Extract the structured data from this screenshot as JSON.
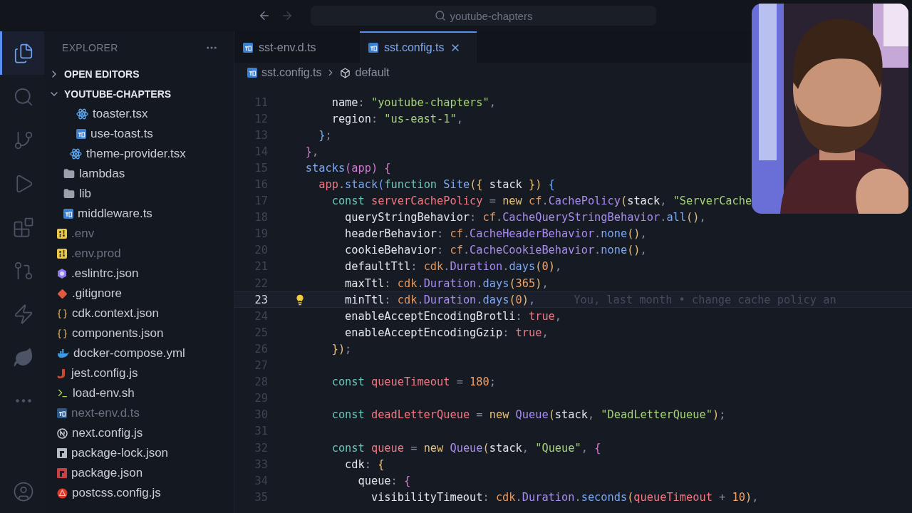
{
  "title_bar": {
    "nav": [
      {
        "kind": "back",
        "disabled": false
      },
      {
        "kind": "forward",
        "disabled": true
      }
    ],
    "command_center": "youtube-chapters"
  },
  "activity_bar": [
    {
      "kind": "explorer",
      "selected": true
    },
    {
      "kind": "search",
      "selected": false
    },
    {
      "kind": "scm",
      "selected": false
    },
    {
      "kind": "debug",
      "selected": false
    },
    {
      "kind": "extensions",
      "selected": false
    },
    {
      "kind": "remote",
      "selected": false
    },
    {
      "kind": "lightning",
      "selected": false
    },
    {
      "kind": "leaf",
      "selected": false
    },
    {
      "kind": "more",
      "selected": false
    },
    {
      "kind": "account",
      "selected": false
    }
  ],
  "explorer": {
    "title": "EXPLORER",
    "sections": [
      {
        "label": "OPEN EDITORS",
        "expanded": false
      },
      {
        "label": "YOUTUBE-CHAPTERS",
        "expanded": true
      }
    ],
    "tree": [
      {
        "children": [
          {
            "children": [
              {
                "children": [
                  {
                    "label": "toaster.tsx",
                    "kind": "react",
                    "ignored": false
                  },
                  {
                    "label": "use-toast.ts",
                    "kind": "ts",
                    "ignored": false
                  }
                ]
              },
              {
                "label": "theme-provider.tsx",
                "kind": "react",
                "ignored": false
              }
            ]
          },
          {
            "label": "lambdas",
            "kind": "folder",
            "ignored": false
          },
          {
            "label": "lib",
            "kind": "folder",
            "ignored": false
          },
          {
            "label": "middleware.ts",
            "kind": "ts",
            "ignored": false
          }
        ]
      },
      {
        "label": ".env",
        "kind": "env",
        "ignored": true
      },
      {
        "label": ".env.prod",
        "kind": "env",
        "ignored": true
      },
      {
        "label": ".eslintrc.json",
        "kind": "eslint",
        "ignored": false
      },
      {
        "label": ".gitignore",
        "kind": "git",
        "ignored": false
      },
      {
        "label": "cdk.context.json",
        "kind": "json",
        "ignored": false
      },
      {
        "label": "components.json",
        "kind": "json",
        "ignored": false
      },
      {
        "label": "docker-compose.yml",
        "kind": "docker",
        "ignored": false
      },
      {
        "label": "jest.config.js",
        "kind": "jest",
        "ignored": false
      },
      {
        "label": "load-env.sh",
        "kind": "shell",
        "ignored": false
      },
      {
        "label": "next-env.d.ts",
        "kind": "ts",
        "ignored": true
      },
      {
        "label": "next.config.js",
        "kind": "next",
        "ignored": false
      },
      {
        "label": "package-lock.json",
        "kind": "npm",
        "ignored": false
      },
      {
        "label": "package.json",
        "kind": "npmred",
        "ignored": false
      },
      {
        "label": "postcss.config.js",
        "kind": "postcss",
        "ignored": false
      }
    ]
  },
  "tabs": [
    {
      "label": "sst-env.d.ts",
      "selected": false
    },
    {
      "label": "sst.config.ts",
      "selected": true
    }
  ],
  "breadcrumbs": [
    {
      "label": "sst.config.ts",
      "kind": "file"
    },
    {
      "label": "default",
      "kind": "symbol"
    }
  ],
  "lines": [
    {
      "n": "11",
      "current": false,
      "tokens": [
        {
          "text": "        name",
          "kind": "prop"
        },
        {
          "text": ":",
          "kind": "p"
        },
        {
          "text": " \"youtube-chapters\"",
          "kind": "str"
        },
        {
          "text": ",",
          "kind": "p"
        }
      ]
    },
    {
      "n": "12",
      "current": false,
      "tokens": [
        {
          "text": "        region",
          "kind": "prop"
        },
        {
          "text": ":",
          "kind": "p"
        },
        {
          "text": " \"us-east-1\"",
          "kind": "str"
        },
        {
          "text": ",",
          "kind": "p"
        }
      ]
    },
    {
      "n": "13",
      "current": false,
      "tokens": [
        {
          "text": "      }",
          "kind": "b3"
        },
        {
          "text": ";",
          "kind": "p"
        }
      ]
    },
    {
      "n": "14",
      "current": false,
      "tokens": [
        {
          "text": "    }",
          "kind": "b2"
        },
        {
          "text": ",",
          "kind": "p"
        }
      ]
    },
    {
      "n": "15",
      "current": false,
      "tokens": [
        {
          "text": "    stacks",
          "kind": "fn"
        },
        {
          "text": "(app) {",
          "kind": "b2"
        }
      ]
    },
    {
      "n": "16",
      "current": false,
      "tokens": [
        {
          "text": "      app",
          "kind": "var"
        },
        {
          "text": ".",
          "kind": "p"
        },
        {
          "text": "stack",
          "kind": "fn"
        },
        {
          "text": "(",
          "kind": "b3"
        },
        {
          "text": "function",
          "kind": "kw"
        },
        {
          "text": " Site",
          "kind": "fn"
        },
        {
          "text": "({",
          "kind": "b1"
        },
        {
          "text": " stack ",
          "kind": "prop"
        },
        {
          "text": "})",
          "kind": "b1"
        },
        {
          "text": " {",
          "kind": "b3"
        }
      ]
    },
    {
      "n": "17",
      "current": false,
      "tokens": [
        {
          "text": "        const",
          "kind": "kw"
        },
        {
          "text": " serverCachePolicy",
          "kind": "var"
        },
        {
          "text": " =",
          "kind": "p"
        },
        {
          "text": " new",
          "kind": "kw2"
        },
        {
          "text": " cf",
          "kind": "obj"
        },
        {
          "text": ".",
          "kind": "p"
        },
        {
          "text": "CachePolicy",
          "kind": "cls"
        },
        {
          "text": "(",
          "kind": "b1"
        },
        {
          "text": "stack",
          "kind": "prop"
        },
        {
          "text": ",",
          "kind": "p"
        },
        {
          "text": " \"ServerCache",
          "kind": "str"
        }
      ]
    },
    {
      "n": "18",
      "current": false,
      "tokens": [
        {
          "text": "          queryStringBehavior",
          "kind": "prop"
        },
        {
          "text": ":",
          "kind": "p"
        },
        {
          "text": " cf",
          "kind": "obj"
        },
        {
          "text": ".",
          "kind": "p"
        },
        {
          "text": "CacheQueryStringBehavior",
          "kind": "cls"
        },
        {
          "text": ".",
          "kind": "p"
        },
        {
          "text": "all",
          "kind": "fn"
        },
        {
          "text": "()",
          "kind": "b1"
        },
        {
          "text": ",",
          "kind": "p"
        }
      ]
    },
    {
      "n": "19",
      "current": false,
      "tokens": [
        {
          "text": "          headerBehavior",
          "kind": "prop"
        },
        {
          "text": ":",
          "kind": "p"
        },
        {
          "text": " cf",
          "kind": "obj"
        },
        {
          "text": ".",
          "kind": "p"
        },
        {
          "text": "CacheHeaderBehavior",
          "kind": "cls"
        },
        {
          "text": ".",
          "kind": "p"
        },
        {
          "text": "none",
          "kind": "fn"
        },
        {
          "text": "()",
          "kind": "b1"
        },
        {
          "text": ",",
          "kind": "p"
        }
      ]
    },
    {
      "n": "20",
      "current": false,
      "tokens": [
        {
          "text": "          cookieBehavior",
          "kind": "prop"
        },
        {
          "text": ":",
          "kind": "p"
        },
        {
          "text": " cf",
          "kind": "obj"
        },
        {
          "text": ".",
          "kind": "p"
        },
        {
          "text": "CacheCookieBehavior",
          "kind": "cls"
        },
        {
          "text": ".",
          "kind": "p"
        },
        {
          "text": "none",
          "kind": "fn"
        },
        {
          "text": "()",
          "kind": "b1"
        },
        {
          "text": ",",
          "kind": "p"
        }
      ]
    },
    {
      "n": "21",
      "current": false,
      "tokens": [
        {
          "text": "          defaultTtl",
          "kind": "prop"
        },
        {
          "text": ":",
          "kind": "p"
        },
        {
          "text": " cdk",
          "kind": "obj"
        },
        {
          "text": ".",
          "kind": "p"
        },
        {
          "text": "Duration",
          "kind": "cls"
        },
        {
          "text": ".",
          "kind": "p"
        },
        {
          "text": "days",
          "kind": "fn"
        },
        {
          "text": "(",
          "kind": "b1"
        },
        {
          "text": "0",
          "kind": "num"
        },
        {
          "text": ")",
          "kind": "b1"
        },
        {
          "text": ",",
          "kind": "p"
        }
      ]
    },
    {
      "n": "22",
      "current": false,
      "tokens": [
        {
          "text": "          maxTtl",
          "kind": "prop"
        },
        {
          "text": ":",
          "kind": "p"
        },
        {
          "text": " cdk",
          "kind": "obj"
        },
        {
          "text": ".",
          "kind": "p"
        },
        {
          "text": "Duration",
          "kind": "cls"
        },
        {
          "text": ".",
          "kind": "p"
        },
        {
          "text": "days",
          "kind": "fn"
        },
        {
          "text": "(",
          "kind": "b1"
        },
        {
          "text": "365",
          "kind": "num"
        },
        {
          "text": ")",
          "kind": "b1"
        },
        {
          "text": ",",
          "kind": "p"
        }
      ]
    },
    {
      "n": "23",
      "current": true,
      "tokens": [
        {
          "text": "          minTtl",
          "kind": "prop"
        },
        {
          "text": ":",
          "kind": "p"
        },
        {
          "text": " cdk",
          "kind": "obj"
        },
        {
          "text": ".",
          "kind": "p"
        },
        {
          "text": "Duration",
          "kind": "cls"
        },
        {
          "text": ".",
          "kind": "p"
        },
        {
          "text": "days",
          "kind": "fn"
        },
        {
          "text": "(",
          "kind": "b1"
        },
        {
          "text": "0",
          "kind": "num"
        },
        {
          "text": ")",
          "kind": "b1"
        },
        {
          "text": ",",
          "kind": "p"
        }
      ],
      "blame": "You, last month • change cache policy an"
    },
    {
      "n": "24",
      "current": false,
      "tokens": [
        {
          "text": "          enableAcceptEncodingBrotli",
          "kind": "prop"
        },
        {
          "text": ":",
          "kind": "p"
        },
        {
          "text": " true",
          "kind": "bool"
        },
        {
          "text": ",",
          "kind": "p"
        }
      ]
    },
    {
      "n": "25",
      "current": false,
      "tokens": [
        {
          "text": "          enableAcceptEncodingGzip",
          "kind": "prop"
        },
        {
          "text": ":",
          "kind": "p"
        },
        {
          "text": " true",
          "kind": "bool"
        },
        {
          "text": ",",
          "kind": "p"
        }
      ]
    },
    {
      "n": "26",
      "current": false,
      "tokens": [
        {
          "text": "        })",
          "kind": "b1"
        },
        {
          "text": ";",
          "kind": "p"
        }
      ]
    },
    {
      "n": "27",
      "current": false
    },
    {
      "n": "28",
      "current": false,
      "tokens": [
        {
          "text": "        const",
          "kind": "kw"
        },
        {
          "text": " queueTimeout",
          "kind": "var"
        },
        {
          "text": " =",
          "kind": "p"
        },
        {
          "text": " 180",
          "kind": "num"
        },
        {
          "text": ";",
          "kind": "p"
        }
      ]
    },
    {
      "n": "29",
      "current": false
    },
    {
      "n": "30",
      "current": false,
      "tokens": [
        {
          "text": "        const",
          "kind": "kw"
        },
        {
          "text": " deadLetterQueue",
          "kind": "var"
        },
        {
          "text": " =",
          "kind": "p"
        },
        {
          "text": " new",
          "kind": "kw2"
        },
        {
          "text": " Queue",
          "kind": "cls"
        },
        {
          "text": "(",
          "kind": "b1"
        },
        {
          "text": "stack",
          "kind": "prop"
        },
        {
          "text": ",",
          "kind": "p"
        },
        {
          "text": " \"DeadLetterQueue\"",
          "kind": "str"
        },
        {
          "text": ")",
          "kind": "b1"
        },
        {
          "text": ";",
          "kind": "p"
        }
      ]
    },
    {
      "n": "31",
      "current": false
    },
    {
      "n": "32",
      "current": false,
      "tokens": [
        {
          "text": "        const",
          "kind": "kw"
        },
        {
          "text": " queue",
          "kind": "var"
        },
        {
          "text": " =",
          "kind": "p"
        },
        {
          "text": " new",
          "kind": "kw2"
        },
        {
          "text": " Queue",
          "kind": "cls"
        },
        {
          "text": "(",
          "kind": "b1"
        },
        {
          "text": "stack",
          "kind": "prop"
        },
        {
          "text": ",",
          "kind": "p"
        },
        {
          "text": " \"Queue\"",
          "kind": "str"
        },
        {
          "text": ",",
          "kind": "p"
        },
        {
          "text": " {",
          "kind": "b2"
        }
      ]
    },
    {
      "n": "33",
      "current": false,
      "tokens": [
        {
          "text": "          cdk",
          "kind": "prop"
        },
        {
          "text": ":",
          "kind": "p"
        },
        {
          "text": " {",
          "kind": "b1"
        }
      ]
    },
    {
      "n": "34",
      "current": false,
      "tokens": [
        {
          "text": "            queue",
          "kind": "prop"
        },
        {
          "text": ":",
          "kind": "p"
        },
        {
          "text": " {",
          "kind": "b2"
        }
      ]
    },
    {
      "n": "35",
      "current": false,
      "tokens": [
        {
          "text": "              visibilityTimeout",
          "kind": "prop"
        },
        {
          "text": ":",
          "kind": "p"
        },
        {
          "text": " cdk",
          "kind": "obj"
        },
        {
          "text": ".",
          "kind": "p"
        },
        {
          "text": "Duration",
          "kind": "cls"
        },
        {
          "text": ".",
          "kind": "p"
        },
        {
          "text": "seconds",
          "kind": "fn"
        },
        {
          "text": "(",
          "kind": "b1"
        },
        {
          "text": "queueTimeout",
          "kind": "var"
        },
        {
          "text": " +",
          "kind": "p"
        },
        {
          "text": " 10",
          "kind": "num"
        },
        {
          "text": ")",
          "kind": "b1"
        },
        {
          "text": ",",
          "kind": "p"
        }
      ]
    }
  ]
}
